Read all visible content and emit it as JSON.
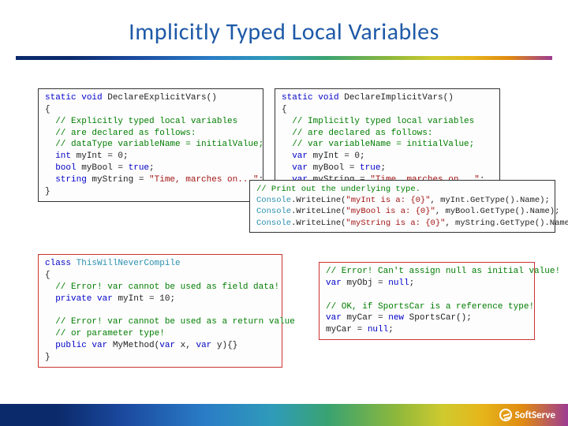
{
  "title": "Implicitly Typed Local Variables",
  "footer": {
    "brand": "SoftServe"
  },
  "box1": {
    "sig_kw1": "static",
    "sig_kw2": "void",
    "sig_name": " DeclareExplicitVars()",
    "c1": "// Explicitly typed local variables",
    "c2": "// are declared as follows:",
    "c3": "// dataType variableName = initialValue;",
    "l1_kw": "int",
    "l1_rest": " myInt = 0;",
    "l2_kw": "bool",
    "l2_rest": " myBool = ",
    "l2_kw2": "true",
    "l2_end": ";",
    "l3_kw": "string",
    "l3_rest": " myString = ",
    "l3_str": "\"Time, marches on...\"",
    "l3_end": ";"
  },
  "box2": {
    "sig_kw1": "static",
    "sig_kw2": "void",
    "sig_name": " DeclareImplicitVars()",
    "c1": "// Implicitly typed local variables",
    "c2": "// are declared as follows:",
    "c3": "// var variableName = initialValue;",
    "l1_kw": "var",
    "l1_rest": " myInt = 0;",
    "l2_kw": "var",
    "l2_rest": " myBool = ",
    "l2_kw2": "true",
    "l2_end": ";",
    "l3_kw": "var",
    "l3_rest": " myString = ",
    "l3_str": "\"Time, marches on...\"",
    "l3_end": ";"
  },
  "box3": {
    "c1": "// Print out the underlying type.",
    "l1a": "Console",
    "l1b": ".WriteLine(",
    "l1s": "\"myInt is a: {0}\"",
    "l1c": ", myInt.GetType().Name);",
    "l2a": "Console",
    "l2b": ".WriteLine(",
    "l2s": "\"myBool is a: {0}\"",
    "l2c": ", myBool.GetType().Name);",
    "l3a": "Console",
    "l3b": ".WriteLine(",
    "l3s": "\"myString is a: {0}\"",
    "l3c": ", myString.GetType().Name);"
  },
  "box4": {
    "cls_kw": "class",
    "cls_name": " ThisWillNeverCompile",
    "c1": "// Error! var cannot be used as field data!",
    "l1_kw1": "private",
    "l1_kw2": "var",
    "l1_rest": " myInt = 10;",
    "c2": "// Error! var cannot be used as a return value",
    "c3": "// or parameter type!",
    "l2_kw1": "public",
    "l2_kw2": "var",
    "l2a": " MyMethod(",
    "l2_kw3": "var",
    "l2b": " x, ",
    "l2_kw4": "var",
    "l2c": " y){}"
  },
  "box5": {
    "c1": "// Error! Can't assign null as initial value!",
    "l1_kw": "var",
    "l1a": " myObj = ",
    "l1_kw2": "null",
    "l1b": ";",
    "c2": "// OK, if SportsCar is a reference type!",
    "l2_kw": "var",
    "l2a": " myCar = ",
    "l2_kw2": "new",
    "l2b": " SportsCar();",
    "l3a": "myCar = ",
    "l3_kw": "null",
    "l3b": ";"
  }
}
